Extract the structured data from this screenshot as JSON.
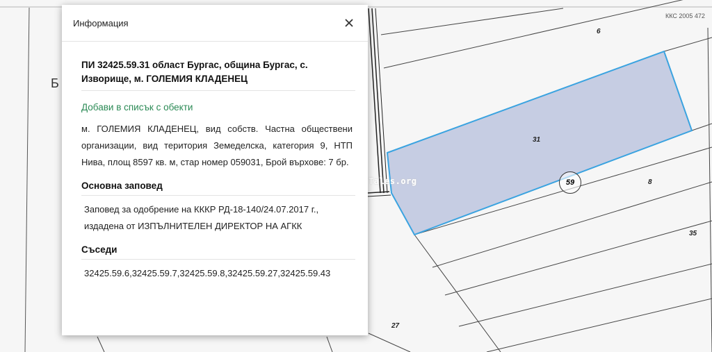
{
  "map": {
    "kkc_label": "ККС 2005 472",
    "edge_letter": "Б",
    "watermark": "Tales.org",
    "parcel_numbers": {
      "p6": "6",
      "p31": "31",
      "p59": "59",
      "p8": "8",
      "p35": "35",
      "p27": "27"
    },
    "highlight_color": "#c6cde3",
    "highlight_border": "#3aa3e0"
  },
  "popup": {
    "title": "Информация",
    "parcel_title": "ПИ 32425.59.31 област Бургас, община Бургас, с. Изворище, м. ГОЛЕМИЯ КЛАДЕНЕЦ",
    "add_link": "Добави в списък с обекти",
    "description": "м. ГОЛЕМИЯ КЛАДЕНЕЦ, вид собств. Частна обществени организации, вид територия Земеделска, категория 9, НТП Нива, площ 8597 кв. м, стар номер 059031, Брой върхове: 7 бр.",
    "order_heading": "Основна заповед",
    "order_text": "Заповед за одобрение на КККР РД-18-140/24.07.2017 г., издадена от ИЗПЪЛНИТЕЛЕН ДИРЕКТОР НА АГКК",
    "neighbors_heading": "Съседи",
    "neighbors": [
      "32425.59.6,",
      "32425.59.7,",
      "32425.59.8,",
      "32425.59.27,",
      "32425.59.43"
    ]
  }
}
